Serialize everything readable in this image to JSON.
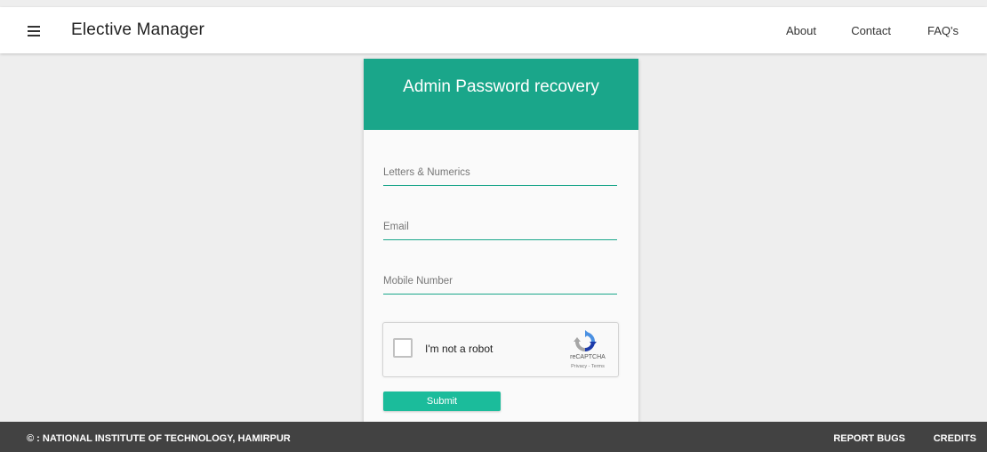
{
  "header": {
    "title": "Elective Manager",
    "menu_icon": "hamburger-menu-icon",
    "nav": [
      "About",
      "Contact",
      "FAQ's"
    ]
  },
  "card": {
    "title": "Admin Password recovery",
    "fields": {
      "letters_placeholder": "Letters & Numerics",
      "email_placeholder": "Email",
      "mobile_placeholder": "Mobile Number"
    },
    "captcha": {
      "label": "I'm not a robot",
      "brand": "reCAPTCHA",
      "links": "Privacy - Terms",
      "icon": "recaptcha-logo-icon"
    },
    "submit_label": "Submit"
  },
  "footer": {
    "copyright": "© : NATIONAL INSTITUTE OF TECHNOLOGY, HAMIRPUR",
    "links": [
      "REPORT BUGS",
      "CREDITS"
    ]
  },
  "colors": {
    "accent": "#1aa68a",
    "button": "#1bbc9b",
    "footer": "#424242",
    "background": "#eeeeee"
  }
}
